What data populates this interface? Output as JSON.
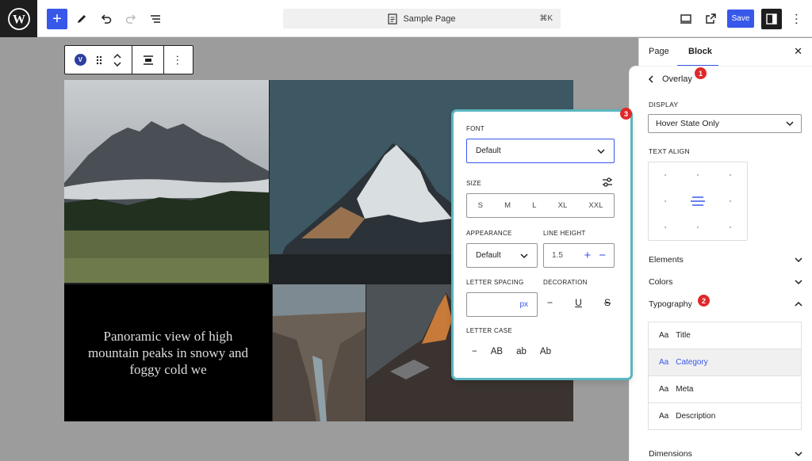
{
  "topbar": {
    "command_title": "Sample Page",
    "command_shortcut": "⌘K",
    "save_label": "Save"
  },
  "block_toolbar": {
    "block_icon_letter": "V"
  },
  "canvas": {
    "caption": "Panoramic view of high mountain peaks in snowy and foggy cold we"
  },
  "sidebar": {
    "tabs": [
      "Page",
      "Block"
    ],
    "active_tab": "Block",
    "back_title": "Overlay",
    "display_label": "DISPLAY",
    "display_value": "Hover State Only",
    "text_align_label": "TEXT ALIGN",
    "sections": {
      "elements": "Elements",
      "colors": "Colors",
      "typography": "Typography",
      "dimensions": "Dimensions"
    },
    "typography_items": [
      {
        "aa": "Aa",
        "label": "Title"
      },
      {
        "aa": "Aa",
        "label": "Category"
      },
      {
        "aa": "Aa",
        "label": "Meta"
      },
      {
        "aa": "Aa",
        "label": "Description"
      }
    ],
    "selected_typography": "Category"
  },
  "badges": [
    "1",
    "2",
    "3"
  ],
  "popover": {
    "font_label": "FONT",
    "font_value": "Default",
    "size_label": "SIZE",
    "sizes": [
      "S",
      "M",
      "L",
      "XL",
      "XXL"
    ],
    "appearance_label": "APPEARANCE",
    "appearance_value": "Default",
    "line_height_label": "LINE HEIGHT",
    "line_height_value": "1.5",
    "letter_spacing_label": "LETTER SPACING",
    "letter_spacing_unit": "px",
    "decoration_label": "DECORATION",
    "letter_case_label": "LETTER CASE",
    "letter_case_options": [
      "AB",
      "ab",
      "Ab"
    ]
  },
  "colors": {
    "accent": "#3858e9",
    "badge": "#e02828",
    "popover_outline": "#5ab6c0",
    "selected_row": "#f0f0f0"
  }
}
